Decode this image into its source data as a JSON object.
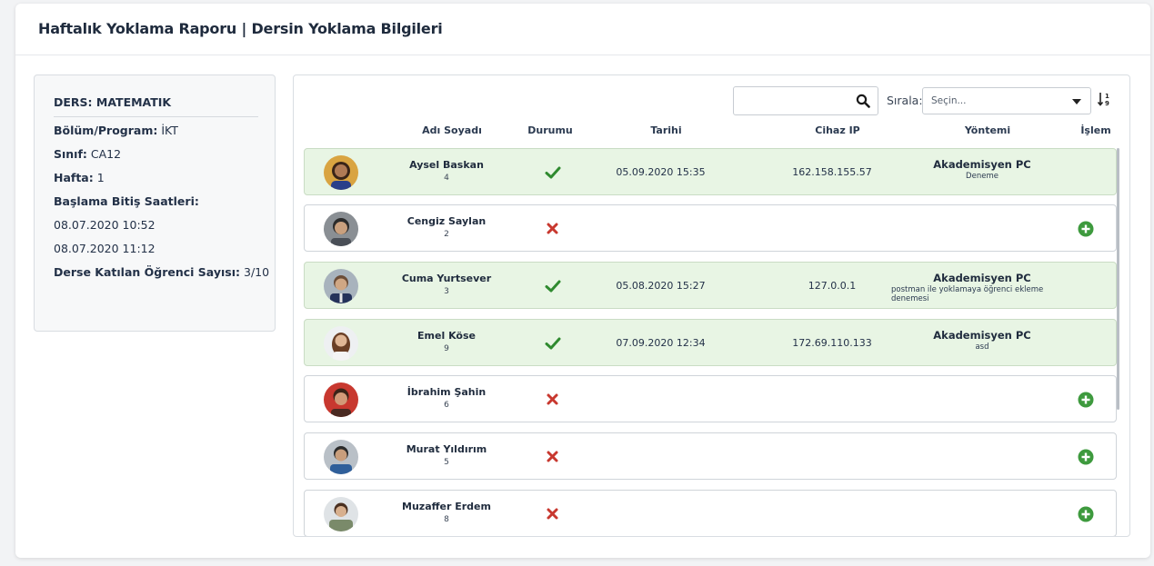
{
  "page": {
    "title": "Haftalık Yoklama Raporu | Dersin Yoklama Bilgileri"
  },
  "course_info": {
    "course_label": "DERS:",
    "course_value": "MATEMATIK",
    "program_label": "Bölüm/Program:",
    "program_value": "İKT",
    "class_label": "Sınıf:",
    "class_value": "CA12",
    "week_label": "Hafta:",
    "week_value": "1",
    "times_label": "Başlama Bitiş Saatleri:",
    "start_time": "08.07.2020 10:52",
    "end_time": "08.07.2020 11:12",
    "count_label": "Derse Katılan Öğrenci Sayısı:",
    "count_value": "3/10"
  },
  "toolbar": {
    "search_value": "",
    "search_icon": "search-icon",
    "sort_label": "Sırala:",
    "sort_placeholder": "Seçin...",
    "sort_order_icon": "sort-numeric-icon"
  },
  "columns": {
    "name": "Adı Soyadı",
    "status": "Durumu",
    "date": "Tarihi",
    "ip": "Cihaz IP",
    "method": "Yöntemi",
    "action": "İşlem"
  },
  "colors": {
    "present_bg": "#e8f5e4",
    "check": "#2f8a2f",
    "cross": "#c8382f",
    "add": "#3e9a3e"
  },
  "students": [
    {
      "name": "Aysel Baskan",
      "no": "4",
      "present": true,
      "date": "05.09.2020 15:35",
      "ip": "162.158.155.57",
      "method": "Akademisyen PC",
      "note": "Deneme"
    },
    {
      "name": "Cengiz Saylan",
      "no": "2",
      "present": false,
      "date": "",
      "ip": "",
      "method": "",
      "note": ""
    },
    {
      "name": "Cuma Yurtsever",
      "no": "3",
      "present": true,
      "date": "05.08.2020 15:27",
      "ip": "127.0.0.1",
      "method": "Akademisyen PC",
      "note": "postman ile yoklamaya öğrenci ekleme denemesi"
    },
    {
      "name": "Emel Köse",
      "no": "9",
      "present": true,
      "date": "07.09.2020 12:34",
      "ip": "172.69.110.133",
      "method": "Akademisyen PC",
      "note": "asd"
    },
    {
      "name": "İbrahim Şahin",
      "no": "6",
      "present": false,
      "date": "",
      "ip": "",
      "method": "",
      "note": ""
    },
    {
      "name": "Murat Yıldırım",
      "no": "5",
      "present": false,
      "date": "",
      "ip": "",
      "method": "",
      "note": ""
    },
    {
      "name": "Muzaffer Erdem",
      "no": "8",
      "present": false,
      "date": "",
      "ip": "",
      "method": "",
      "note": ""
    }
  ]
}
